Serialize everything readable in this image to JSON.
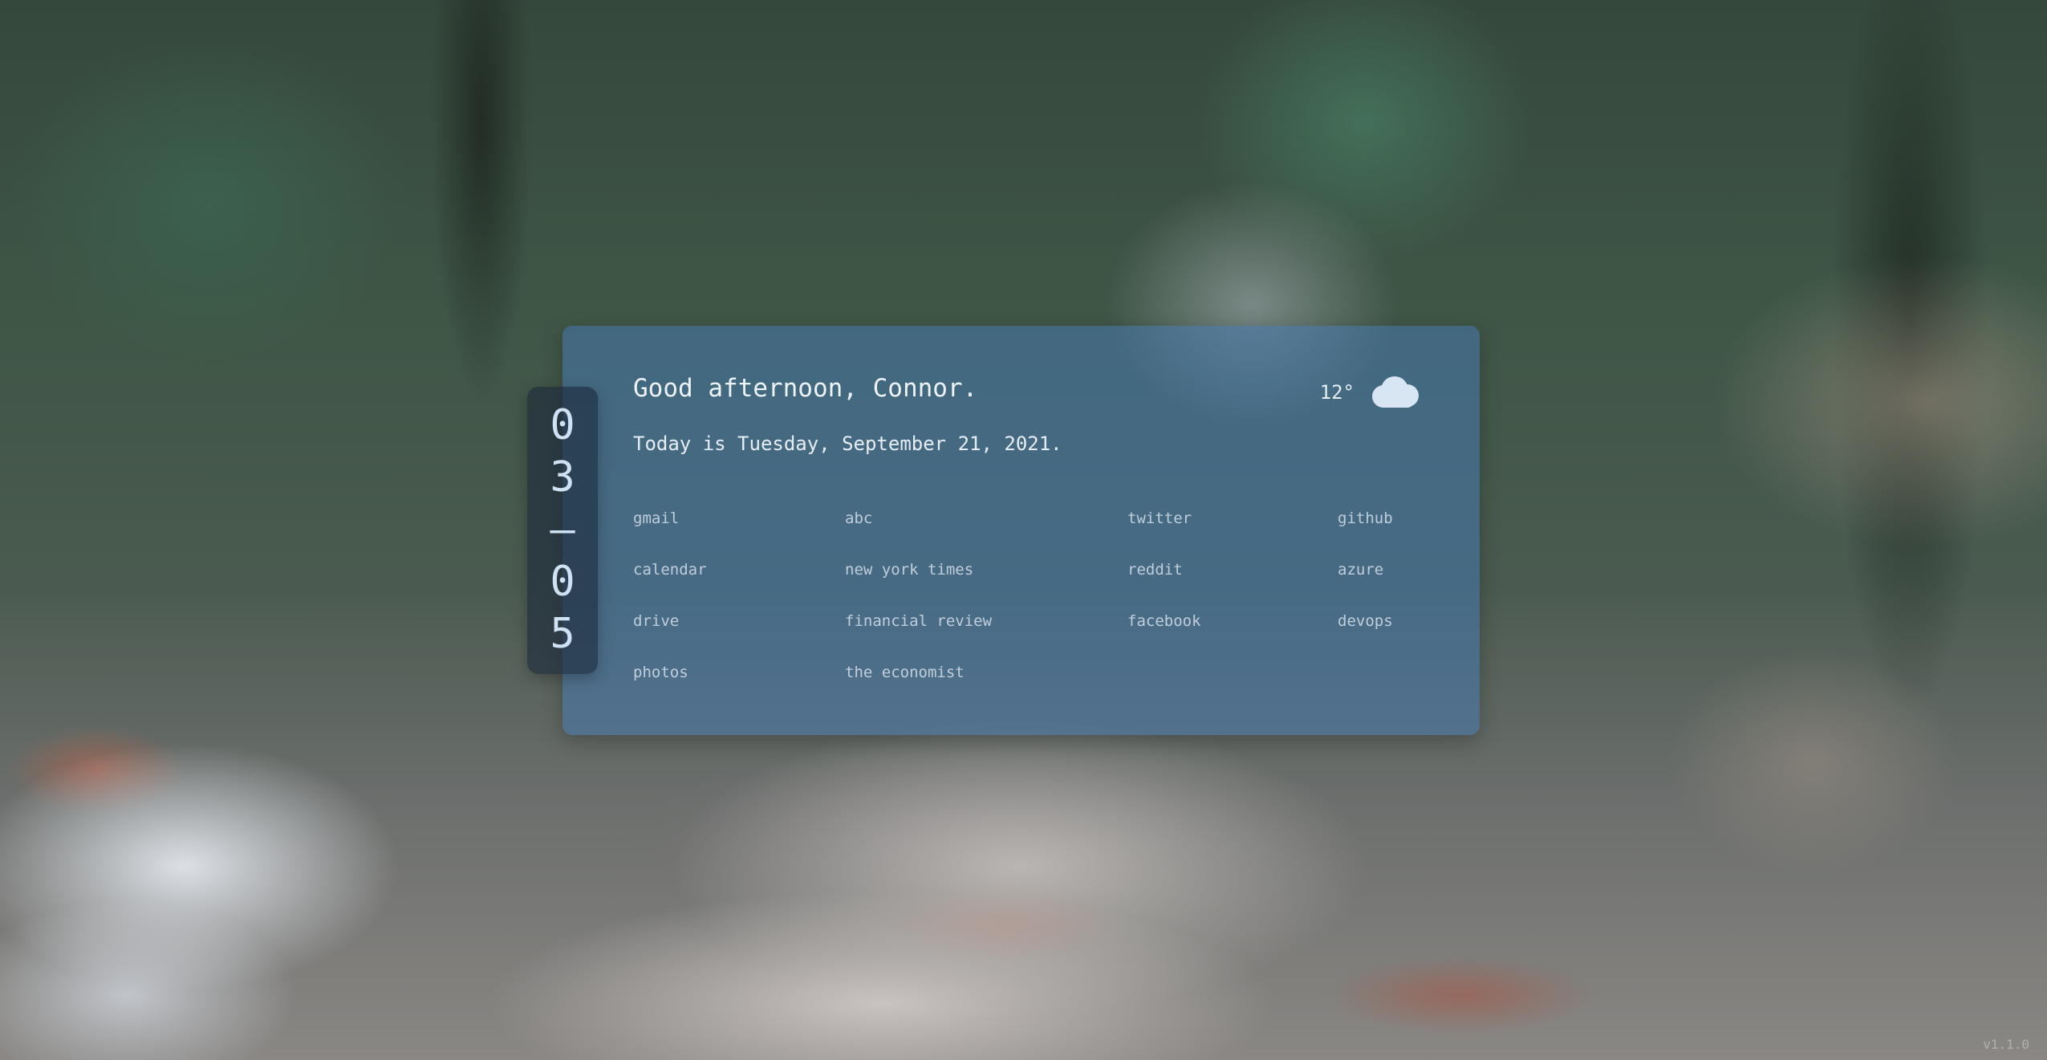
{
  "greeting": "Good afternoon, Connor.",
  "date_line": "Today is Tuesday, September 21, 2021.",
  "weather": {
    "temperature": "12°",
    "icon": "cloud-icon"
  },
  "clock": {
    "digits": [
      "0",
      "3",
      "–",
      "0",
      "5"
    ]
  },
  "links": {
    "col1": [
      "gmail",
      "calendar",
      "drive",
      "photos"
    ],
    "col2": [
      "abc",
      "new york times",
      "financial review",
      "the economist"
    ],
    "col3": [
      "twitter",
      "reddit",
      "facebook"
    ],
    "col4": [
      "github",
      "azure",
      "devops"
    ]
  },
  "version": "v1.1.0",
  "colors": {
    "card": "#4678af",
    "clock_bg": "#1c283a",
    "clock_digits": "#cfe2f3",
    "text": "#eef3f8"
  }
}
